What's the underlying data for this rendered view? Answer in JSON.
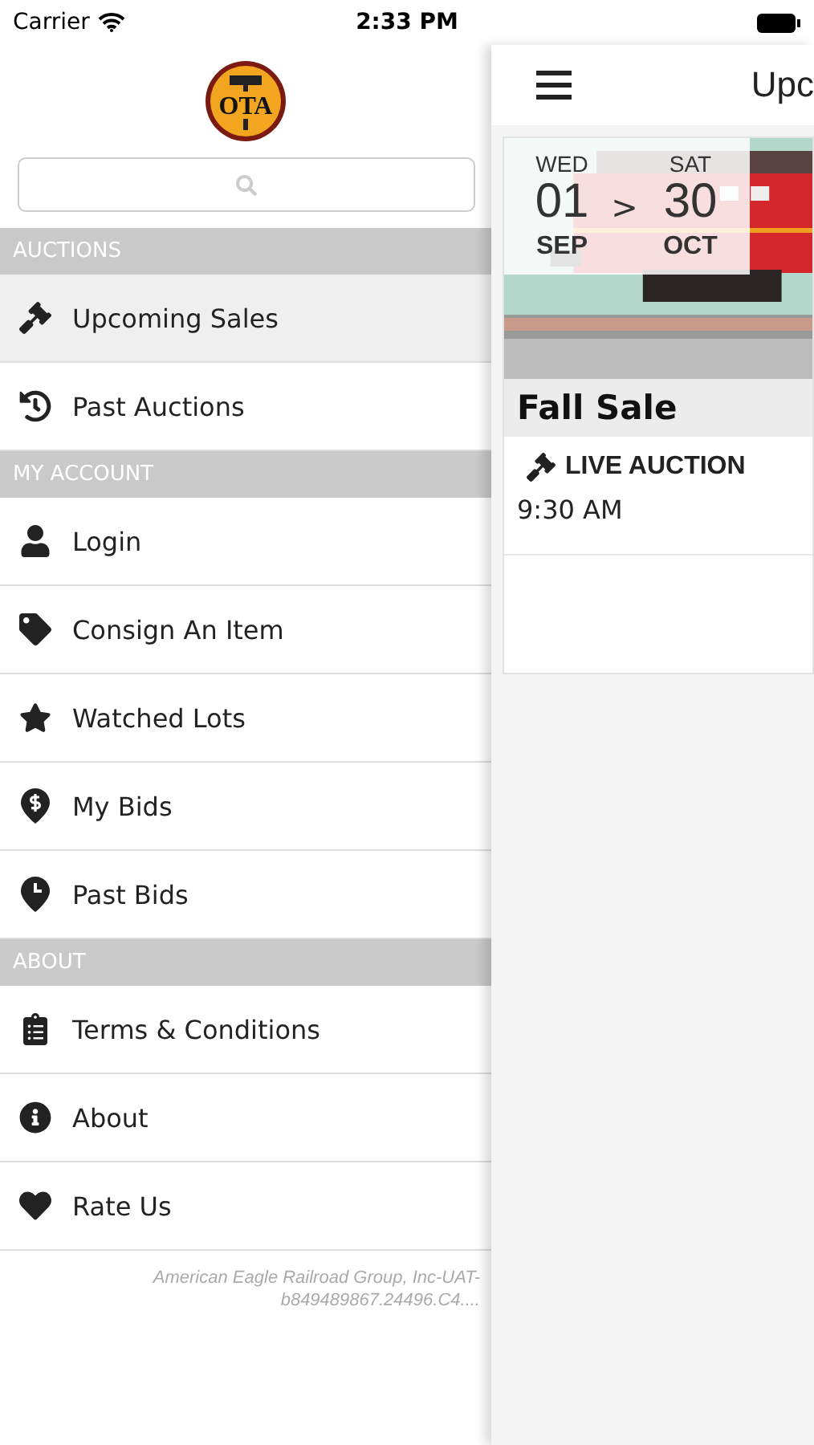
{
  "status_bar": {
    "carrier": "Carrier",
    "time": "2:33 PM"
  },
  "sidebar": {
    "logo": "OTA",
    "sections": [
      {
        "title": "AUCTIONS",
        "items": [
          {
            "label": "Upcoming Sales",
            "selected": true
          },
          {
            "label": "Past Auctions",
            "selected": false
          }
        ]
      },
      {
        "title": "MY ACCOUNT",
        "items": [
          {
            "label": "Login",
            "selected": false
          },
          {
            "label": "Consign An Item",
            "selected": false
          },
          {
            "label": "Watched Lots",
            "selected": false
          },
          {
            "label": "My Bids",
            "selected": false
          },
          {
            "label": "Past Bids",
            "selected": false
          }
        ]
      },
      {
        "title": "ABOUT",
        "items": [
          {
            "label": "Terms & Conditions",
            "selected": false
          },
          {
            "label": "About",
            "selected": false
          },
          {
            "label": "Rate Us",
            "selected": false
          }
        ]
      }
    ],
    "footer": "American Eagle Railroad Group, Inc-UAT-b849489867.24496.C4...."
  },
  "main": {
    "title": "Upc",
    "sale": {
      "start": {
        "weekday": "WED",
        "day": "01",
        "month": "SEP"
      },
      "separator": ">",
      "end": {
        "weekday": "SAT",
        "day": "30",
        "month": "OCT"
      },
      "name": "Fall Sale",
      "type": "LIVE AUCTION",
      "time": "9:30 AM"
    }
  }
}
